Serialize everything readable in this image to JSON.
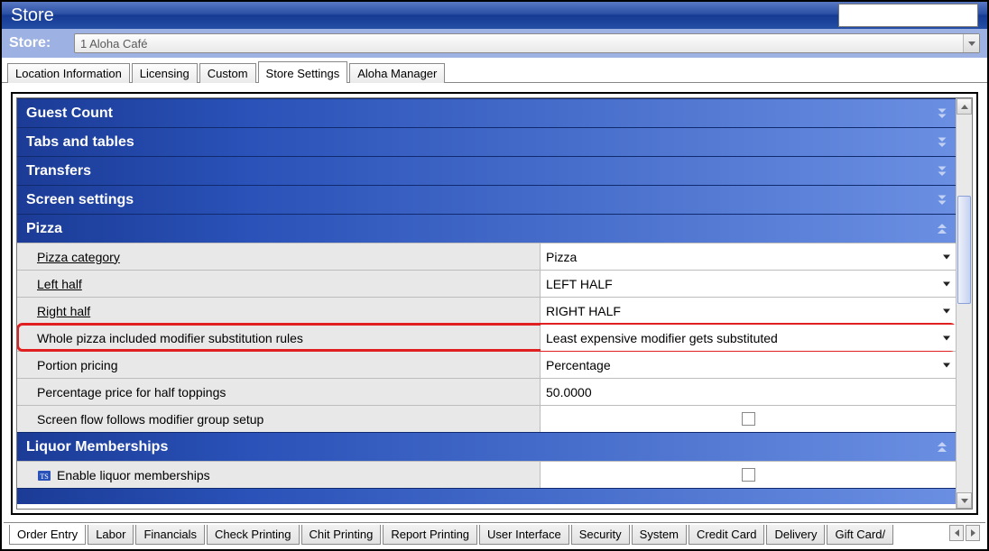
{
  "window": {
    "title": "Store"
  },
  "store_selector": {
    "label": "Store:",
    "value": "1 Aloha Café"
  },
  "top_tabs": {
    "items": [
      {
        "label": "Location Information"
      },
      {
        "label": "Licensing"
      },
      {
        "label": "Custom"
      },
      {
        "label": "Store Settings"
      },
      {
        "label": "Aloha Manager"
      }
    ],
    "active_index": 3
  },
  "sections": {
    "collapsed": [
      {
        "label": "Guest Count"
      },
      {
        "label": "Tabs and tables"
      },
      {
        "label": "Transfers"
      },
      {
        "label": "Screen settings"
      }
    ],
    "pizza": {
      "label": "Pizza",
      "rows": [
        {
          "label": "Pizza category",
          "value": "Pizza",
          "type": "dropdown",
          "underline": true
        },
        {
          "label": "Left half",
          "value": "LEFT HALF",
          "type": "dropdown",
          "underline": true
        },
        {
          "label": "Right half",
          "value": "RIGHT HALF",
          "type": "dropdown",
          "underline": true
        },
        {
          "label": "Whole pizza included modifier substitution rules",
          "value": "Least expensive modifier gets substituted",
          "type": "dropdown",
          "underline": false,
          "highlight": true
        },
        {
          "label": "Portion pricing",
          "value": "Percentage",
          "type": "dropdown",
          "underline": false
        },
        {
          "label": "Percentage price for half toppings",
          "value": "50.0000",
          "type": "text",
          "underline": false
        },
        {
          "label": "Screen flow follows modifier group setup",
          "value": "",
          "type": "checkbox",
          "underline": false,
          "checked": false
        }
      ]
    },
    "liquor": {
      "label": "Liquor Memberships",
      "rows": [
        {
          "label": "Enable liquor memberships",
          "value": "",
          "type": "checkbox",
          "underline": false,
          "checked": false,
          "icon": "ts-icon"
        }
      ]
    }
  },
  "bottom_tabs": {
    "items": [
      {
        "label": "Order Entry"
      },
      {
        "label": "Labor"
      },
      {
        "label": "Financials"
      },
      {
        "label": "Check Printing"
      },
      {
        "label": "Chit Printing"
      },
      {
        "label": "Report Printing"
      },
      {
        "label": "User Interface"
      },
      {
        "label": "Security"
      },
      {
        "label": "System"
      },
      {
        "label": "Credit Card"
      },
      {
        "label": "Delivery"
      },
      {
        "label": "Gift Card/"
      }
    ],
    "active_index": 0
  }
}
